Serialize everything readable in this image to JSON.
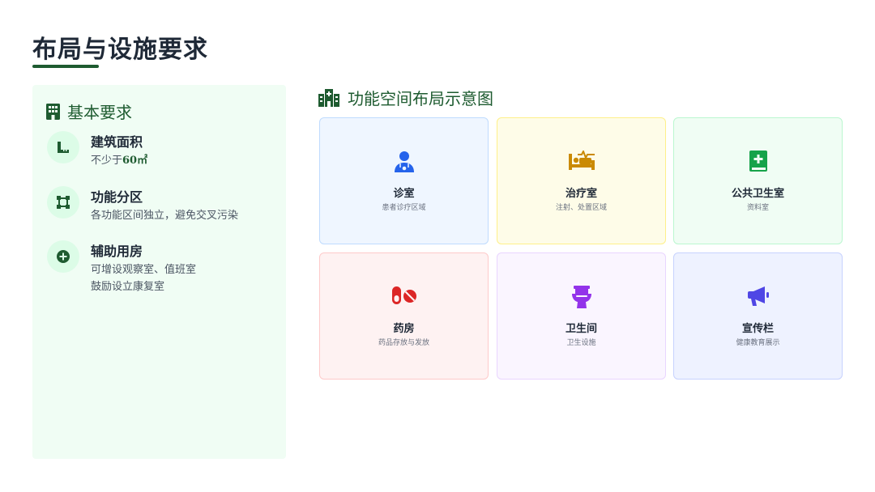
{
  "page": {
    "title": "布局与设施要求"
  },
  "requirements": {
    "heading": "基本要求",
    "items": [
      {
        "title": "建筑面积",
        "desc_prefix": "不少于",
        "desc_value": "60㎡",
        "icon": "ruler-icon"
      },
      {
        "title": "功能分区",
        "desc": "各功能区间独立，避免交叉污染",
        "icon": "vector-square-icon"
      },
      {
        "title": "辅助用房",
        "desc_lines": [
          "可增设观察室、值班室",
          "鼓励设立康复室"
        ],
        "icon": "plus-circle-icon"
      }
    ]
  },
  "layout_section": {
    "heading": "功能空间布局示意图",
    "rooms": [
      {
        "name": "诊室",
        "desc": "患者诊疗区域",
        "icon": "doctor-icon",
        "bg": "#eff6ff",
        "border": "#bfdbfe",
        "color": "#2563eb"
      },
      {
        "name": "治疗室",
        "desc": "注射、处置区域",
        "icon": "bed-pulse-icon",
        "bg": "#fefce8",
        "border": "#fef08a",
        "color": "#ca8a04"
      },
      {
        "name": "公共卫生室",
        "desc": "资料室",
        "icon": "medical-book-icon",
        "bg": "#f0fdf4",
        "border": "#bbf7d0",
        "color": "#16a34a"
      },
      {
        "name": "药房",
        "desc": "药品存放与发放",
        "icon": "pills-icon",
        "bg": "#fef2f2",
        "border": "#fecaca",
        "color": "#dc2626"
      },
      {
        "name": "卫生间",
        "desc": "卫生设施",
        "icon": "toilet-icon",
        "bg": "#faf5ff",
        "border": "#e9d5ff",
        "color": "#9333ea"
      },
      {
        "name": "宣传栏",
        "desc": "健康教育展示",
        "icon": "megaphone-icon",
        "bg": "#eef2ff",
        "border": "#c7d2fe",
        "color": "#4f46e5"
      }
    ]
  },
  "colors": {
    "accent": "#1e5b30",
    "panel_bg": "#f0fdf4",
    "icon_circle": "#dcfce7"
  }
}
